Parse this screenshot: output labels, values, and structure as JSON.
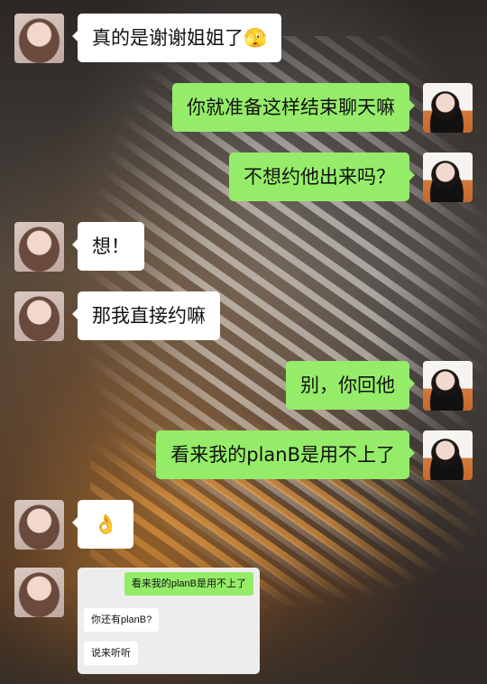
{
  "chat": {
    "messages": [
      {
        "side": "left",
        "text": "真的是谢谢姐姐了",
        "emoji": "🫣"
      },
      {
        "side": "right",
        "text": "你就准备这样结束聊天嘛"
      },
      {
        "side": "right",
        "text": "不想约他出来吗？"
      },
      {
        "side": "left",
        "text": "想！"
      },
      {
        "side": "left",
        "text": "那我直接约嘛"
      },
      {
        "side": "right",
        "text": "别，你回他"
      },
      {
        "side": "right",
        "text": "看来我的planB是用不上了"
      },
      {
        "side": "left",
        "emoji": "👌"
      },
      {
        "side": "left",
        "screenshot": {
          "messages": [
            {
              "side": "right",
              "text": "看来我的planB是用不上了"
            },
            {
              "side": "left",
              "text": "你还有planB?"
            },
            {
              "side": "left",
              "text": "说来听听"
            }
          ]
        }
      }
    ]
  },
  "colors": {
    "bubble_self": "#95ec69",
    "bubble_other": "#ffffff"
  }
}
